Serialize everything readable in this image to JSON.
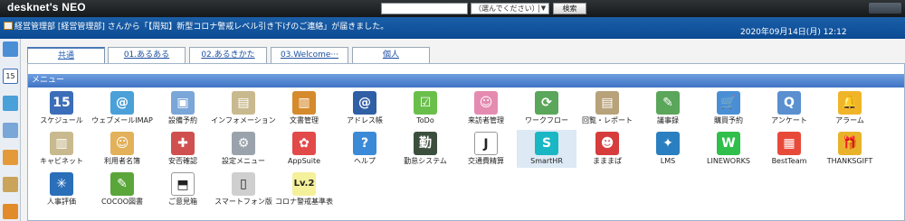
{
  "topbar": {
    "logo_text": "desknet's NEO",
    "search": {
      "value": "",
      "placeholder": ""
    },
    "scope_select": {
      "selected": "（選んでください）"
    },
    "search_button": "検索"
  },
  "infobar": {
    "notification": "経営管理部 [経営管理部] さんから「【周知】新型コロナ警戒レベル引き下げのご連絡」が届きました。",
    "datetime": "2020年09月14日(月) 12:12"
  },
  "left_rail": {
    "items": [
      {
        "icon": "portal-icon",
        "color": "#4a8fd6"
      },
      {
        "icon": "calendar-icon",
        "label": "15",
        "color": "#3b6db8"
      },
      {
        "icon": "mail-icon",
        "color": "#4aa0d8"
      },
      {
        "icon": "facility-icon",
        "color": "#7aa6d8"
      },
      {
        "icon": "memo-icon",
        "color": "#e59a3a"
      },
      {
        "icon": "notepad-icon",
        "color": "#c9a45a"
      },
      {
        "icon": "apps-icon",
        "color": "#e28b2a"
      }
    ]
  },
  "tabs": [
    {
      "label": "共通",
      "active": true
    },
    {
      "label": "01.あるある",
      "active": false
    },
    {
      "label": "02.あるきかた",
      "active": false
    },
    {
      "label": "03.Welcome···",
      "active": false
    },
    {
      "label": "個人",
      "active": false
    }
  ],
  "menu": {
    "title": "メニュー",
    "apps": [
      {
        "label": "スケジュール",
        "icon": "schedule-icon",
        "color": "#3b6db8",
        "glyph": "15"
      },
      {
        "label": "ウェブメールIMAP",
        "icon": "webmail-icon",
        "color": "#4aa0d8",
        "glyph": "@"
      },
      {
        "label": "設備予約",
        "icon": "facility-booking-icon",
        "color": "#7aa6d8",
        "glyph": "▣"
      },
      {
        "label": "インフォメーション",
        "icon": "information-icon",
        "color": "#c9b98e",
        "glyph": "▤"
      },
      {
        "label": "文書管理",
        "icon": "document-icon",
        "color": "#d58a2c",
        "glyph": "▥"
      },
      {
        "label": "アドレス帳",
        "icon": "address-book-icon",
        "color": "#2f5fa5",
        "glyph": "@"
      },
      {
        "label": "ToDo",
        "icon": "todo-icon",
        "color": "#6abf4b",
        "glyph": "☑"
      },
      {
        "label": "来訪者管理",
        "icon": "visitor-icon",
        "color": "#e58bb0",
        "glyph": "☺"
      },
      {
        "label": "ワークフロー",
        "icon": "workflow-icon",
        "color": "#5aa65a",
        "glyph": "⟳"
      },
      {
        "label": "回覧・レポート",
        "icon": "circular-report-icon",
        "color": "#b8a27a",
        "glyph": "▤"
      },
      {
        "label": "議事録",
        "icon": "minutes-icon",
        "color": "#5aa65a",
        "glyph": "✎"
      },
      {
        "label": "購買予約",
        "icon": "purchase-icon",
        "color": "#4a8fd6",
        "glyph": "🛒"
      },
      {
        "label": "アンケート",
        "icon": "survey-icon",
        "color": "#5a8fd0",
        "glyph": "Q"
      },
      {
        "label": "アラーム",
        "icon": "alarm-icon",
        "color": "#f0b429",
        "glyph": "🔔"
      },
      {
        "label": "キャビネット",
        "icon": "cabinet-icon",
        "color": "#c9b98e",
        "glyph": "▥"
      },
      {
        "label": "利用者名簿",
        "icon": "user-directory-icon",
        "color": "#e2b15a",
        "glyph": "☺"
      },
      {
        "label": "安否確認",
        "icon": "safety-check-icon",
        "color": "#d05050",
        "glyph": "✚"
      },
      {
        "label": "設定メニュー",
        "icon": "settings-icon",
        "color": "#9aa3ab",
        "glyph": "⚙"
      },
      {
        "label": "AppSuite",
        "icon": "appsuite-icon",
        "color": "#e24a4a",
        "glyph": "✿"
      },
      {
        "label": "ヘルプ",
        "icon": "help-icon",
        "color": "#3a8ad8",
        "glyph": "?"
      },
      {
        "label": "勤怠システム",
        "icon": "attendance-icon",
        "color": "#3c4f3c",
        "glyph": "勤"
      },
      {
        "label": "交通費精算",
        "icon": "transport-expense-icon",
        "color": "#ffffff",
        "glyph": "J"
      },
      {
        "label": "SmartHR",
        "icon": "smarthr-icon",
        "color": "#19b7c3",
        "glyph": "S",
        "selected": true
      },
      {
        "label": "まままぱ",
        "icon": "mascot-icon",
        "color": "#d63c3c",
        "glyph": "☻"
      },
      {
        "label": "LMS",
        "icon": "lms-icon",
        "color": "#2a7fc0",
        "glyph": "✦"
      },
      {
        "label": "LINEWORKS",
        "icon": "lineworks-icon",
        "color": "#2fbf4a",
        "glyph": "W"
      },
      {
        "label": "BestTeam",
        "icon": "bestteam-icon",
        "color": "#e84a3a",
        "glyph": "▦"
      },
      {
        "label": "THANKSGIFT",
        "icon": "thanksgift-icon",
        "color": "#e8b22a",
        "glyph": "🎁"
      },
      {
        "label": "人事評価",
        "icon": "hr-evaluation-icon",
        "color": "#2a6fb8",
        "glyph": "✳"
      },
      {
        "label": "COCOO図書",
        "icon": "library-icon",
        "color": "#5aa63a",
        "glyph": "✎"
      },
      {
        "label": "ご意見箱",
        "icon": "suggestion-box-icon",
        "color": "#ffffff",
        "glyph": "⬒"
      },
      {
        "label": "スマートフォン版",
        "icon": "smartphone-icon",
        "color": "#cfcfcf",
        "glyph": "▯"
      },
      {
        "label": "コロナ警戒基準表",
        "icon": "corona-level-icon",
        "color": "#f5f09a",
        "glyph": "Lv.2"
      }
    ]
  }
}
